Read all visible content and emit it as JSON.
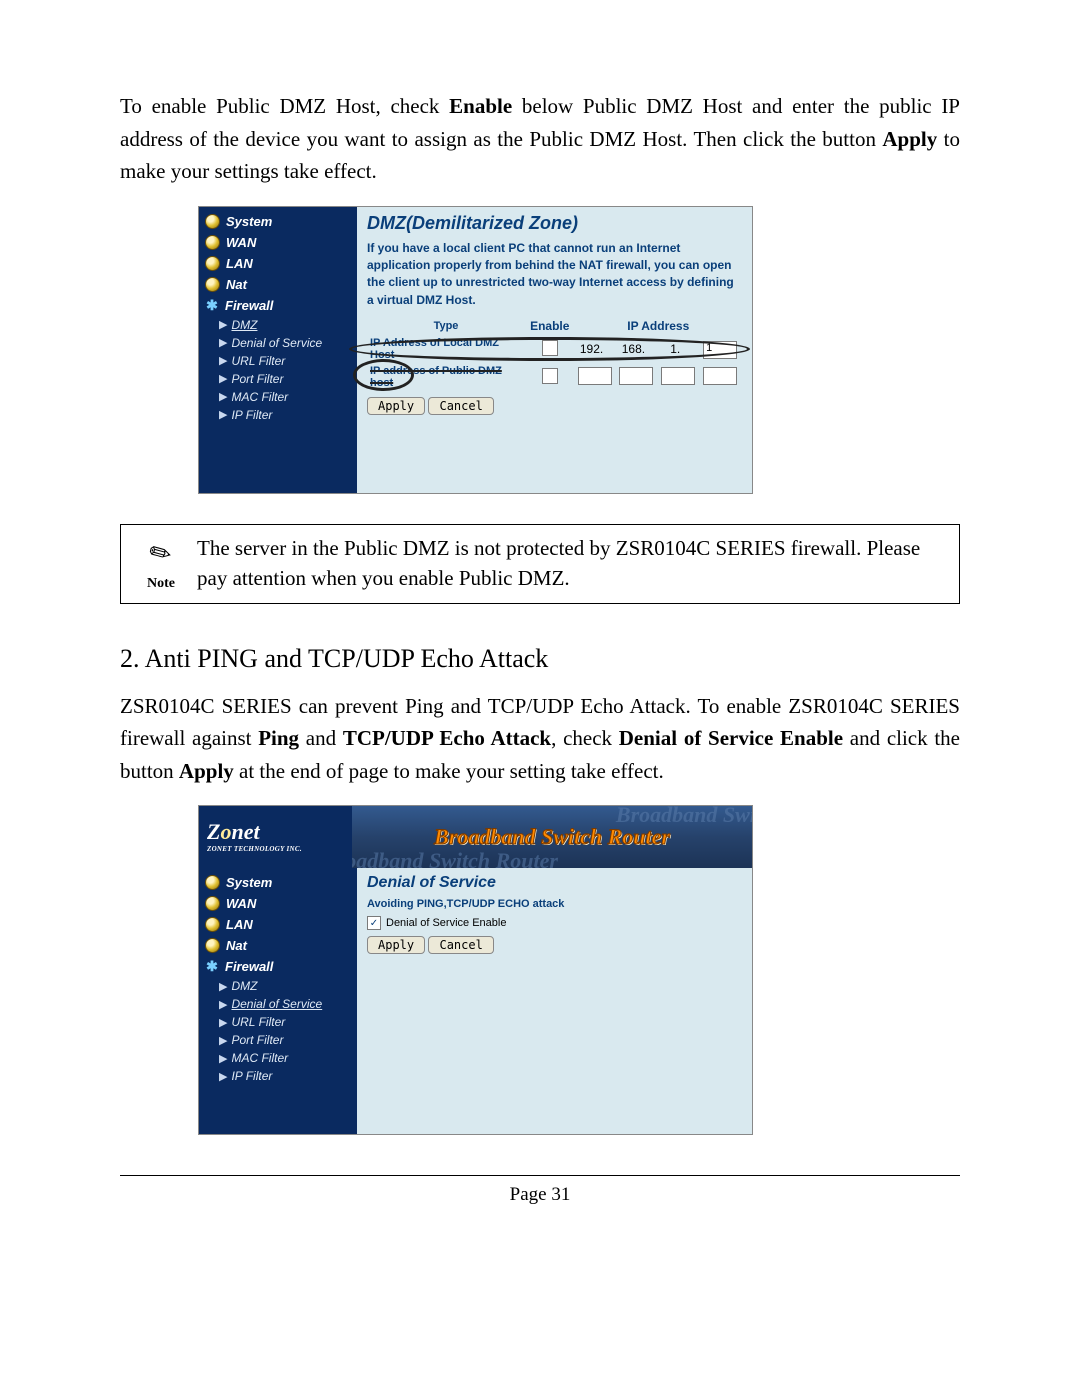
{
  "intro": {
    "pre": "To enable Public DMZ Host, check ",
    "b1": "Enable",
    "mid": " below Public DMZ Host and enter the public IP address of the device you want to assign as the Public DMZ Host. Then click the button ",
    "b2": "Apply",
    "post": " to make your settings take effect."
  },
  "nav": {
    "top": [
      "System",
      "WAN",
      "LAN",
      "Nat",
      "Firewall"
    ],
    "sub": [
      "DMZ",
      "Denial of Service",
      "URL Filter",
      "Port Filter",
      "MAC Filter",
      "IP Filter"
    ]
  },
  "dmz": {
    "title": "DMZ(Demilitarized Zone)",
    "desc": "If you have a local client PC that cannot run an Internet application properly from behind the NAT firewall, you can open the client up to unrestricted two-way Internet access by defining a virtual DMZ Host.",
    "col_type": "Type",
    "col_enable": "Enable",
    "col_ip": "IP Address",
    "row1_label": "IP Address of Local DMZ Host",
    "row1_ip": [
      "192.",
      "168.",
      "1.",
      "1"
    ],
    "row2_label": "IP address of Public DMZ host"
  },
  "buttons": {
    "apply": "Apply",
    "cancel": "Cancel"
  },
  "note": {
    "word": "Note",
    "text": "The server in the Public DMZ is not protected by ZSR0104C SERIES firewall. Please pay attention when you enable Public DMZ."
  },
  "section2": {
    "heading": "2.  Anti PING and TCP/UDP Echo Attack",
    "para_pre": "ZSR0104C SERIES can prevent Ping and TCP/UDP Echo Attack. To enable ZSR0104C SERIES firewall against ",
    "b1": "Ping",
    "mid1": " and ",
    "b2": "TCP/UDP Echo Attack",
    "mid2": ", check ",
    "b3": "Denial of Service Enable",
    "mid3": " and click the button ",
    "b4": "Apply",
    "post": " at the end of page to make your setting take effect."
  },
  "banner": {
    "logo_main": "Zonet",
    "logo_sub": "ZONET TECHNOLOGY INC.",
    "title": "Broadband Switch Router",
    "ghost1": "Broadband Swit",
    "ghost2": "Broadband Switch Router"
  },
  "dos": {
    "title": "Denial of Service",
    "subtitle": "Avoiding PING,TCP/UDP ECHO attack",
    "check_label": "Denial of Service Enable"
  },
  "footer": "Page 31"
}
